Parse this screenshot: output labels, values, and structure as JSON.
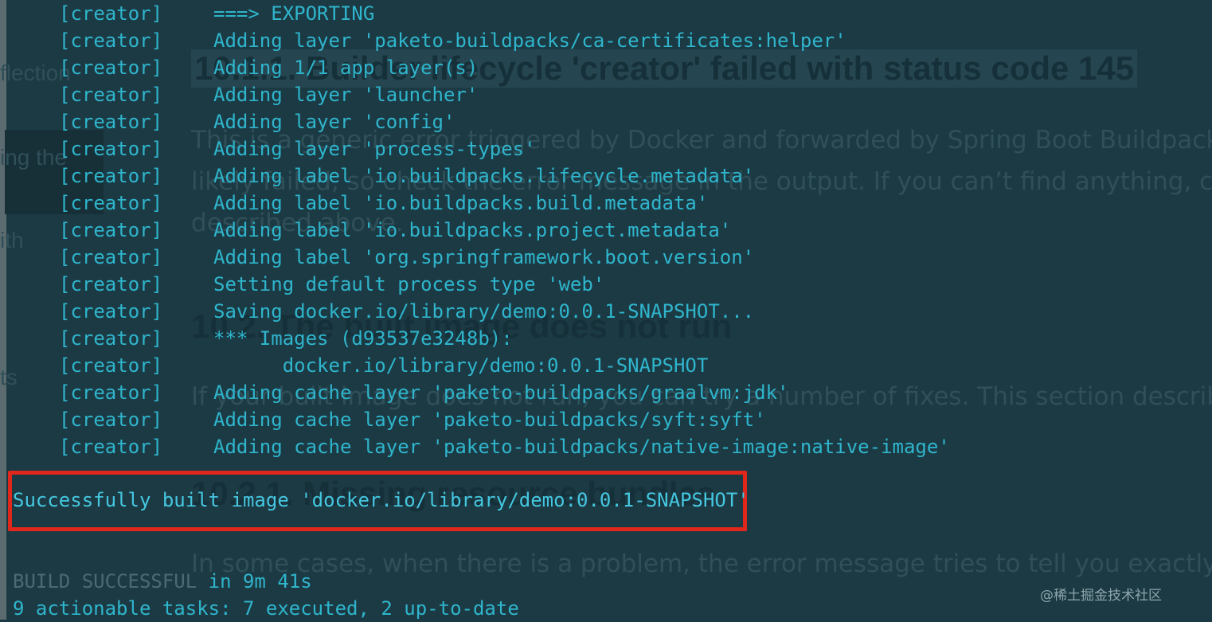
{
  "background_doc": {
    "side_fragments": [
      "flection",
      "ing the",
      "ith",
      "ts"
    ],
    "heading_1": "10.1.1. Builder lifecycle 'creator' failed with status code 145",
    "para_1": [
      "This is a generic error triggered by Docker and forwarded by Spring Boot Buildpacks su",
      "likely failed, so check the error message in the output. If you can’t find anything, check",
      "described above."
    ],
    "heading_2": "10.2. The built image does not run",
    "para_2": "If your built image does not run, you can try a number of fixes. This section describes t",
    "heading_3": "10.2.1. Missing resource bundles",
    "para_3": "In some cases, when there is a problem, the error message tries to tell you exactly wha"
  },
  "terminal": {
    "log_lines": [
      {
        "tag": "[creator]",
        "msg": "===> EXPORTING"
      },
      {
        "tag": "[creator]",
        "msg": "Adding layer 'paketo-buildpacks/ca-certificates:helper'"
      },
      {
        "tag": "[creator]",
        "msg": "Adding 1/1 app layer(s)"
      },
      {
        "tag": "[creator]",
        "msg": "Adding layer 'launcher'"
      },
      {
        "tag": "[creator]",
        "msg": "Adding layer 'config'"
      },
      {
        "tag": "[creator]",
        "msg": "Adding layer 'process-types'"
      },
      {
        "tag": "[creator]",
        "msg": "Adding label 'io.buildpacks.lifecycle.metadata'"
      },
      {
        "tag": "[creator]",
        "msg": "Adding label 'io.buildpacks.build.metadata'"
      },
      {
        "tag": "[creator]",
        "msg": "Adding label 'io.buildpacks.project.metadata'"
      },
      {
        "tag": "[creator]",
        "msg": "Adding label 'org.springframework.boot.version'"
      },
      {
        "tag": "[creator]",
        "msg": "Setting default process type 'web'"
      },
      {
        "tag": "[creator]",
        "msg": "Saving docker.io/library/demo:0.0.1-SNAPSHOT..."
      },
      {
        "tag": "[creator]",
        "msg": "*** Images (d93537e3248b):"
      },
      {
        "tag": "[creator]",
        "msg": "      docker.io/library/demo:0.0.1-SNAPSHOT"
      },
      {
        "tag": "[creator]",
        "msg": "Adding cache layer 'paketo-buildpacks/graalvm:jdk'"
      },
      {
        "tag": "[creator]",
        "msg": "Adding cache layer 'paketo-buildpacks/syft:syft'"
      },
      {
        "tag": "[creator]",
        "msg": "Adding cache layer 'paketo-buildpacks/native-image:native-image'"
      }
    ],
    "success_message": "Successfully built image 'docker.io/library/demo:0.0.1-SNAPSHOT'",
    "build_status_word": "BUILD SUCCESSFUL",
    "build_status_rest": " in 9m 41s",
    "tasks_summary": "9 actionable tasks: 7 executed, 2 up-to-date"
  },
  "colors": {
    "terminal_bg": "#1c3a44",
    "text_cyan": "#2fb5cc",
    "highlight_red": "#e0271b"
  },
  "watermark": "@稀土掘金技术社区"
}
